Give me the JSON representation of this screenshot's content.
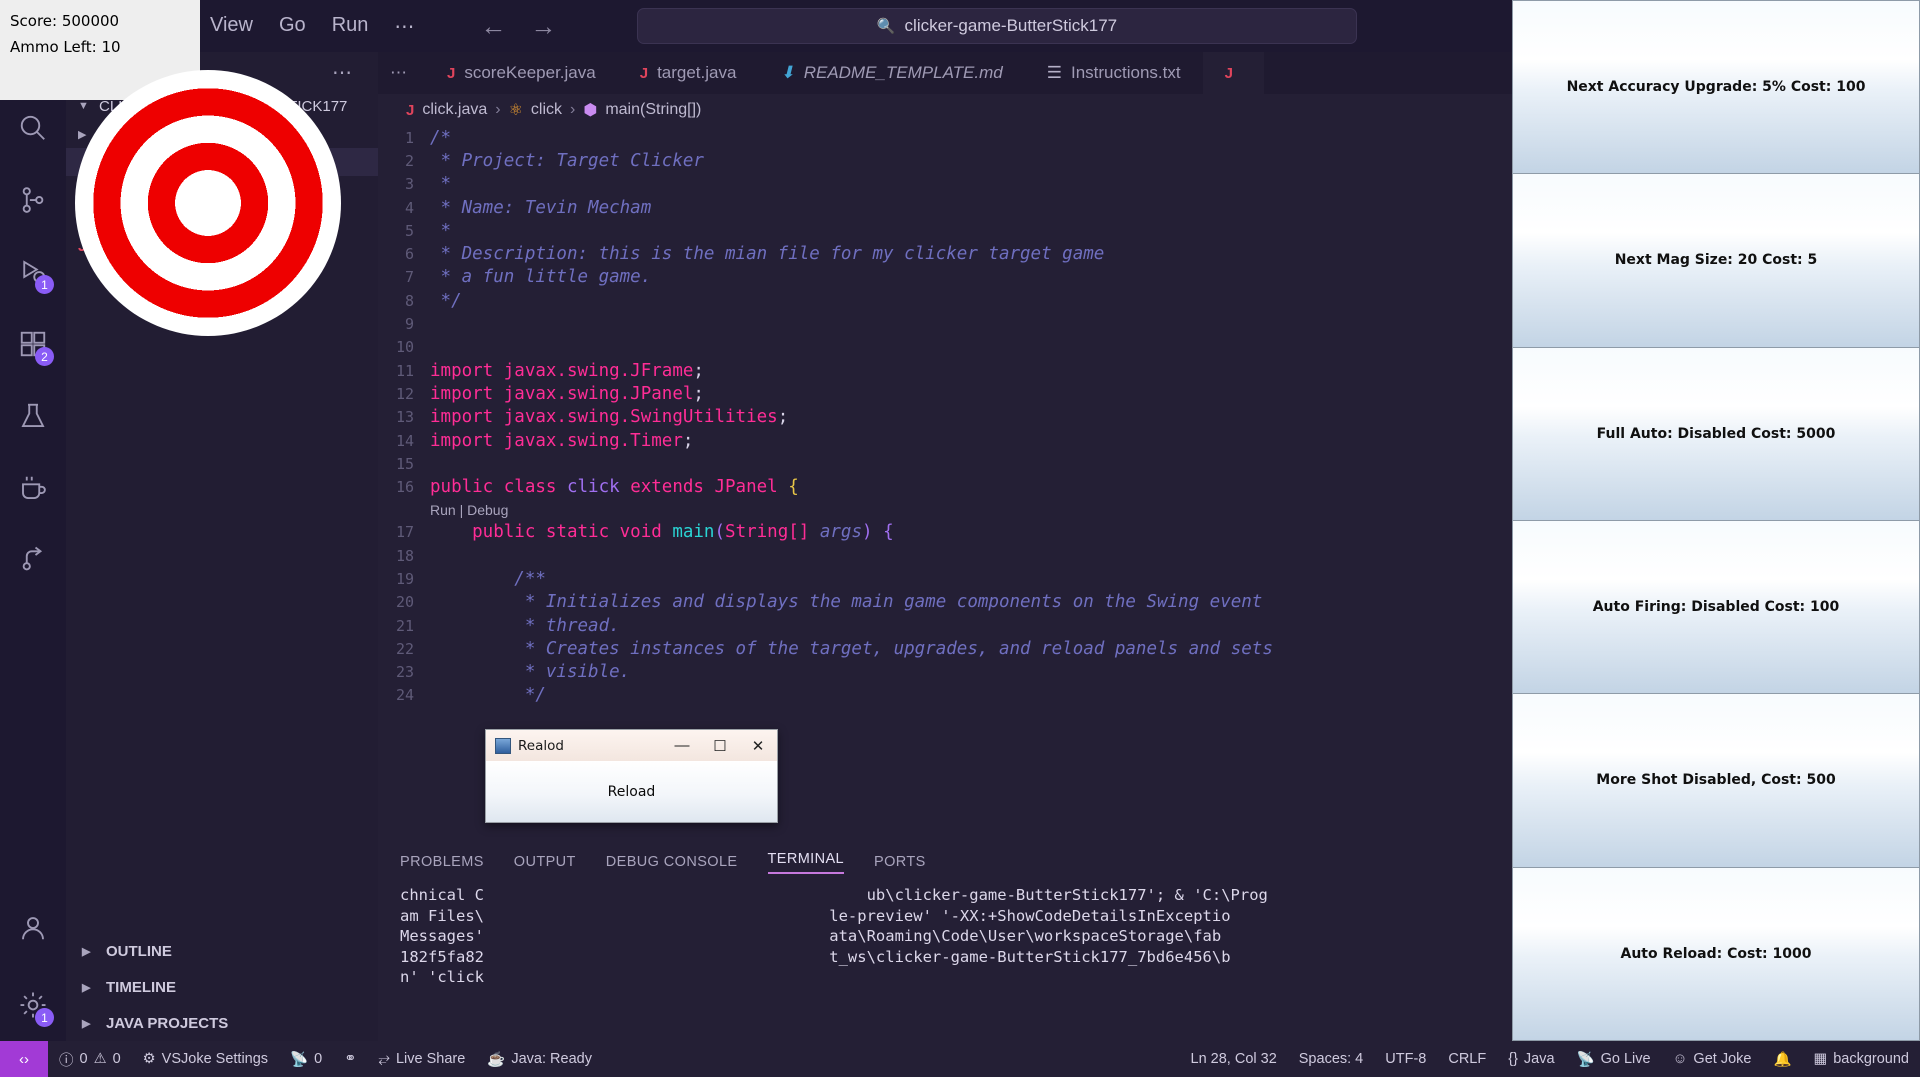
{
  "game": {
    "score_label": "Score: 500000",
    "ammo_label": "Ammo Left: 10",
    "target_icon": "bullseye-target",
    "upgrades": [
      {
        "label": "Next Accuracy Upgrade: 5% Cost: 100"
      },
      {
        "label": "Next Mag Size: 20 Cost: 5"
      },
      {
        "label": "Full Auto: Disabled Cost: 5000"
      },
      {
        "label": "Auto Firing: Disabled Cost: 100"
      },
      {
        "label": "More Shot Disabled, Cost: 500"
      },
      {
        "label": "Auto Reload:  Cost: 1000"
      }
    ],
    "dialog": {
      "title": "Realod",
      "minimize": "—",
      "maximize": "☐",
      "close": "✕",
      "button_label": "Reload"
    }
  },
  "titlebar": {
    "menus": [
      "View",
      "Go",
      "Run",
      "⋯"
    ],
    "back_icon": "arrow-left-icon",
    "forward_icon": "arrow-right-icon",
    "search_icon": "search-icon",
    "omnibox_text": "clicker-game-ButterStick177"
  },
  "activitybar": {
    "items": [
      {
        "name": "search",
        "badge": ""
      },
      {
        "name": "source-control",
        "badge": ""
      },
      {
        "name": "run-and-debug",
        "badge": "1"
      },
      {
        "name": "extensions",
        "badge": "2"
      },
      {
        "name": "testing",
        "badge": ""
      },
      {
        "name": "java-projects",
        "badge": ""
      },
      {
        "name": "remote-explorer",
        "badge": ""
      }
    ],
    "bottom": [
      {
        "name": "accounts",
        "badge": ""
      },
      {
        "name": "settings",
        "badge": "1"
      }
    ]
  },
  "sidebar": {
    "more_icon": "⋯",
    "root_label": "CLICKER-GAME-BUTTERSTICK177",
    "sections": [
      {
        "label": "OUTLINE"
      },
      {
        "label": "TIMELINE"
      },
      {
        "label": "JAVA PROJECTS"
      }
    ]
  },
  "editor": {
    "tabs": [
      {
        "label": "scoreKeeper.java",
        "icon": "java-icon",
        "active": false
      },
      {
        "label": "target.java",
        "icon": "java-icon",
        "active": false
      },
      {
        "label": "README_TEMPLATE.md",
        "icon": "markdown-icon",
        "active": false
      },
      {
        "label": "Instructions.txt",
        "icon": "text-file-icon",
        "active": false
      },
      {
        "label": "",
        "icon": "java-icon",
        "active": true
      }
    ],
    "breadcrumbs": [
      "click.java",
      "click",
      "main(String[])"
    ],
    "codelens": "Run | Debug",
    "lines": [
      {
        "n": "1",
        "segs": [
          {
            "t": "/*",
            "c": "cm"
          }
        ]
      },
      {
        "n": "2",
        "segs": [
          {
            "t": " * Project: Target Clicker",
            "c": "cm"
          }
        ]
      },
      {
        "n": "3",
        "segs": [
          {
            "t": " *",
            "c": "cm"
          }
        ]
      },
      {
        "n": "4",
        "segs": [
          {
            "t": " * Name: Tevin Mecham",
            "c": "cm"
          }
        ]
      },
      {
        "n": "5",
        "segs": [
          {
            "t": " *",
            "c": "cm"
          }
        ]
      },
      {
        "n": "6",
        "segs": [
          {
            "t": " * Description: this is the mian file for my clicker target game",
            "c": "cm"
          }
        ]
      },
      {
        "n": "7",
        "segs": [
          {
            "t": " * a fun little game.",
            "c": "cm"
          }
        ]
      },
      {
        "n": "8",
        "segs": [
          {
            "t": " */",
            "c": "cm"
          }
        ]
      },
      {
        "n": "9",
        "segs": []
      },
      {
        "n": "10",
        "segs": []
      },
      {
        "n": "11",
        "segs": [
          {
            "t": "import",
            "c": "kw"
          },
          {
            "t": " javax.swing.JFrame",
            "c": "kw"
          },
          {
            "t": ";",
            "c": "plain"
          }
        ]
      },
      {
        "n": "12",
        "segs": [
          {
            "t": "import",
            "c": "kw"
          },
          {
            "t": " javax.swing.JPanel",
            "c": "kw"
          },
          {
            "t": ";",
            "c": "plain"
          }
        ]
      },
      {
        "n": "13",
        "segs": [
          {
            "t": "import",
            "c": "kw"
          },
          {
            "t": " javax.swing.SwingUtilities",
            "c": "kw"
          },
          {
            "t": ";",
            "c": "plain"
          }
        ]
      },
      {
        "n": "14",
        "segs": [
          {
            "t": "import",
            "c": "kw"
          },
          {
            "t": " javax.swing.Timer",
            "c": "kw"
          },
          {
            "t": ";",
            "c": "plain"
          }
        ]
      },
      {
        "n": "15",
        "segs": []
      },
      {
        "n": "16",
        "segs": [
          {
            "t": "public class ",
            "c": "kw"
          },
          {
            "t": "click ",
            "c": "kw2"
          },
          {
            "t": "extends ",
            "c": "kw"
          },
          {
            "t": "JPanel ",
            "c": "kw"
          },
          {
            "t": "{",
            "c": "yel"
          }
        ]
      },
      {
        "n": "17",
        "segs": [
          {
            "t": "    public static void ",
            "c": "kw"
          },
          {
            "t": "main",
            "c": "fn"
          },
          {
            "t": "(",
            "c": "kw2"
          },
          {
            "t": "String[] ",
            "c": "kw"
          },
          {
            "t": "args",
            "c": "cm"
          },
          {
            "t": ") {",
            "c": "kw2"
          }
        ]
      },
      {
        "n": "18",
        "segs": []
      },
      {
        "n": "19",
        "segs": [
          {
            "t": "        /**",
            "c": "cm"
          }
        ]
      },
      {
        "n": "20",
        "segs": [
          {
            "t": "         * Initializes and displays the main game components on the Swing event",
            "c": "cm"
          }
        ]
      },
      {
        "n": "21",
        "segs": [
          {
            "t": "         * thread.",
            "c": "cm"
          }
        ]
      },
      {
        "n": "22",
        "segs": [
          {
            "t": "         * Creates instances of the target, upgrades, and reload panels and sets",
            "c": "cm"
          }
        ]
      },
      {
        "n": "23",
        "segs": [
          {
            "t": "         * visible.",
            "c": "cm"
          }
        ]
      },
      {
        "n": "24",
        "segs": [
          {
            "t": "         */",
            "c": "cm"
          }
        ]
      }
    ]
  },
  "panel": {
    "tabs": [
      {
        "label": "PROBLEMS",
        "active": false
      },
      {
        "label": "OUTPUT",
        "active": false
      },
      {
        "label": "DEBUG CONSOLE",
        "active": false
      },
      {
        "label": "TERMINAL",
        "active": true
      },
      {
        "label": "PORTS",
        "active": false
      }
    ],
    "terminal_lines": [
      "chnical C                                         ub\\clicker-game-ButterStick177'; & 'C:\\Prog",
      "am Files\\                                     le-preview' '-XX:+ShowCodeDetailsInExceptio",
      "Messages'                                     ata\\Roaming\\Code\\User\\workspaceStorage\\fab",
      "182f5fa82                                     t_ws\\clicker-game-ButterStick177_7bd6e456\\b",
      "n' 'click"
    ]
  },
  "statusbar": {
    "remote_icon": "remote-window-icon",
    "left": [
      {
        "icon": "error-icon",
        "label": "0"
      },
      {
        "icon": "warning-icon",
        "label": "0"
      },
      {
        "icon": "gear-icon",
        "label": "VSJoke Settings"
      },
      {
        "icon": "broadcast-icon",
        "label": "0"
      },
      {
        "icon": "debug-alt-icon",
        "label": ""
      },
      {
        "icon": "live-share-icon",
        "label": "Live Share"
      },
      {
        "icon": "coffee-icon",
        "label": "Java: Ready"
      }
    ],
    "right": [
      {
        "icon": "",
        "label": "Ln 28, Col 32"
      },
      {
        "icon": "",
        "label": "Spaces: 4"
      },
      {
        "icon": "",
        "label": "UTF-8"
      },
      {
        "icon": "",
        "label": "CRLF"
      },
      {
        "icon": "braces-icon",
        "label": "Java"
      },
      {
        "icon": "broadcast-icon",
        "label": "Go Live"
      },
      {
        "icon": "smiley-icon",
        "label": "Get Joke"
      },
      {
        "icon": "bell-icon",
        "label": ""
      },
      {
        "icon": "layout-icon",
        "label": "background"
      }
    ]
  }
}
